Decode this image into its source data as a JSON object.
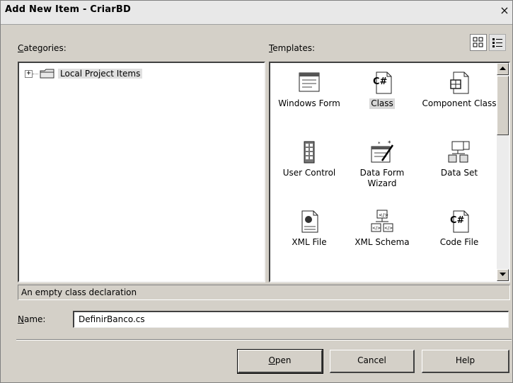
{
  "window": {
    "title": "Add New Item - CriarBD",
    "close_glyph": "×"
  },
  "categories": {
    "label_access_key": "C",
    "label_rest": "ategories:",
    "tree": [
      {
        "label": "Local Project Items",
        "expander": "+",
        "icon": "folder-icon"
      }
    ]
  },
  "templates": {
    "label_access_key": "T",
    "label_rest": "emplates:",
    "view_buttons": [
      "large-icons-view",
      "small-icons-view"
    ],
    "items": [
      {
        "name": "Windows Form",
        "icon": "windows-form-icon"
      },
      {
        "name": "Class",
        "icon": "csharp-class-icon",
        "selected": true
      },
      {
        "name": "Component Class",
        "icon": "component-class-icon"
      },
      {
        "name": "User Control",
        "icon": "user-control-icon"
      },
      {
        "name": "Data Form Wizard",
        "icon": "data-form-wizard-icon"
      },
      {
        "name": "Data Set",
        "icon": "data-set-icon"
      },
      {
        "name": "XML File",
        "icon": "xml-file-icon"
      },
      {
        "name": "XML Schema",
        "icon": "xml-schema-icon"
      },
      {
        "name": "Code File",
        "icon": "code-file-icon"
      }
    ]
  },
  "description": "An empty class declaration",
  "name_field": {
    "label_access_key": "N",
    "label_rest": "ame:",
    "value": "DefinirBanco.cs"
  },
  "buttons": {
    "open_access_key": "O",
    "open_rest": "pen",
    "cancel": "Cancel",
    "help": "Help"
  }
}
